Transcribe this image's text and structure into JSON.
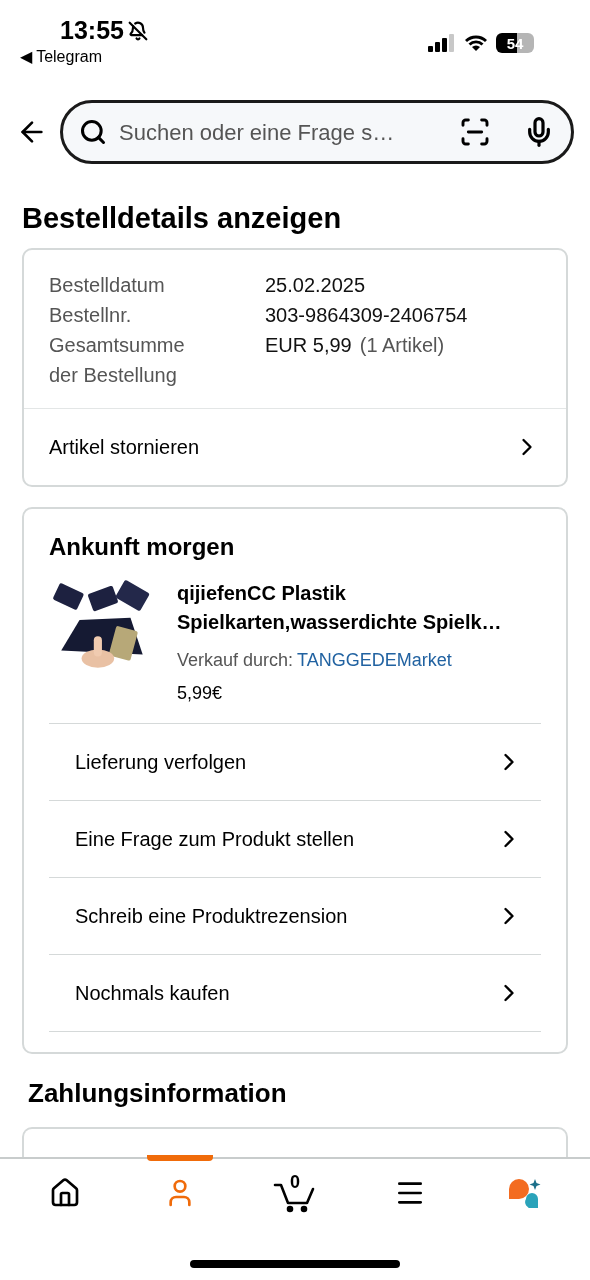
{
  "status_bar": {
    "time": "13:55",
    "back_app": "◀ Telegram",
    "battery": "54"
  },
  "search": {
    "placeholder": "Suchen oder eine Frage s…"
  },
  "title": "Bestelldetails anzeigen",
  "order": {
    "rows": [
      {
        "label": "Bestelldatum",
        "value": "25.02.2025"
      },
      {
        "label": "Bestellnr.",
        "value": "303-9864309-2406754"
      },
      {
        "label": "Gesamtsumme der Bestellung",
        "value": "EUR 5,99",
        "note": "(1 Artikel)"
      }
    ],
    "action": "Artikel stornieren"
  },
  "shipment": {
    "heading": "Ankunft morgen",
    "product": {
      "name": "qijiefenCC Plastik Spielkarten,wasserdichte Spielk…",
      "seller_label": "Verkauf durch:",
      "seller": "TANGGEDEMarket",
      "price": "5,99€"
    },
    "actions": [
      "Lieferung verfolgen",
      "Eine Frage zum Produkt stellen",
      "Schreib eine Produktrezension",
      "Nochmals kaufen"
    ]
  },
  "payment": {
    "heading": "Zahlungsinformation"
  },
  "tab_bar": [
    {
      "kind": "home",
      "selected": false
    },
    {
      "kind": "account",
      "selected": true
    },
    {
      "kind": "cart",
      "count": "0",
      "selected": false
    },
    {
      "kind": "menu",
      "selected": false
    },
    {
      "kind": "assistant",
      "selected": false
    }
  ]
}
